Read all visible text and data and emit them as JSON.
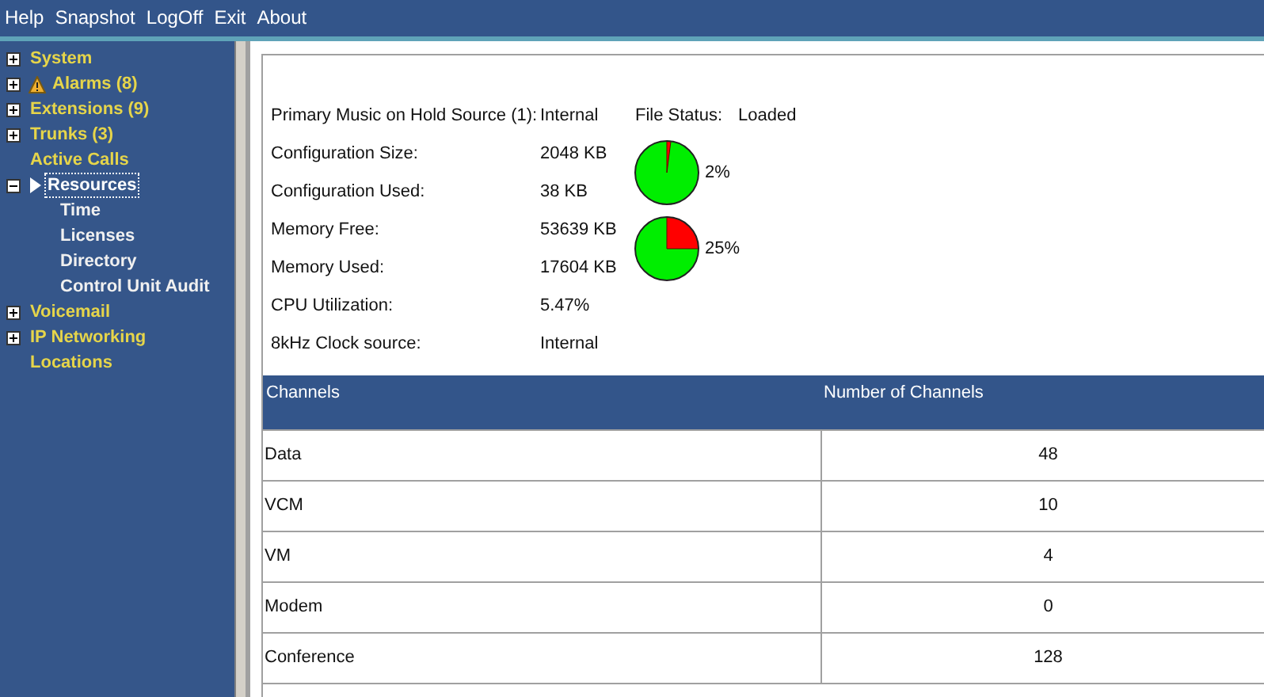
{
  "menu": [
    "Help",
    "Snapshot",
    "LogOff",
    "Exit",
    "About"
  ],
  "tree": [
    {
      "label": "System",
      "expandable": true,
      "expanded": false,
      "selected": false,
      "alert": false
    },
    {
      "label": "Alarms (8)",
      "expandable": true,
      "expanded": false,
      "selected": false,
      "alert": true
    },
    {
      "label": "Extensions (9)",
      "expandable": true,
      "expanded": false,
      "selected": false,
      "alert": false
    },
    {
      "label": "Trunks (3)",
      "expandable": true,
      "expanded": false,
      "selected": false,
      "alert": false
    },
    {
      "label": "Active Calls",
      "expandable": false,
      "selected": false,
      "alert": false
    },
    {
      "label": "Resources",
      "expandable": true,
      "expanded": true,
      "selected": true,
      "alert": false,
      "children": [
        {
          "label": "Time",
          "selected": false
        },
        {
          "label": "Licenses",
          "selected": false
        },
        {
          "label": "Directory",
          "selected": false
        },
        {
          "label": "Control Unit Audit",
          "selected": false
        }
      ]
    },
    {
      "label": "Voicemail",
      "expandable": true,
      "expanded": false,
      "selected": false,
      "alert": false
    },
    {
      "label": "IP Networking",
      "expandable": true,
      "expanded": false,
      "selected": false,
      "alert": false
    },
    {
      "label": "Locations",
      "expandable": false,
      "selected": false,
      "alert": false
    }
  ],
  "info": [
    {
      "label": "Primary Music on Hold Source (1):",
      "value": "Internal"
    },
    {
      "label": "Configuration Size:",
      "value": "2048 KB"
    },
    {
      "label": "Configuration Used:",
      "value": "38 KB"
    },
    {
      "label": "Memory Free:",
      "value": "53639 KB"
    },
    {
      "label": "Memory Used:",
      "value": "17604 KB"
    },
    {
      "label": "CPU Utilization:",
      "value": "5.47%"
    },
    {
      "label": "8kHz Clock source:",
      "value": "Internal"
    }
  ],
  "file_status": {
    "label": "File Status:",
    "value": "Loaded"
  },
  "usage_pies": [
    {
      "reading": "2%"
    },
    {
      "reading": "25%"
    }
  ],
  "table": {
    "columns": [
      "Channels",
      "Number of Channels"
    ],
    "rows": [
      [
        "Data",
        "48"
      ],
      [
        "VCM",
        "10"
      ],
      [
        "VM",
        "4"
      ],
      [
        "Modem",
        "0"
      ],
      [
        "Conference",
        "128"
      ]
    ]
  }
}
